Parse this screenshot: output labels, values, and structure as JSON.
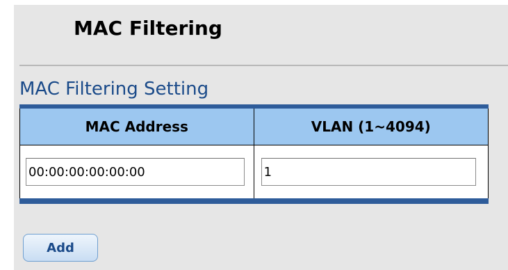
{
  "page": {
    "title": "MAC Filtering"
  },
  "section": {
    "title": "MAC Filtering Setting"
  },
  "table": {
    "headers": {
      "mac_address": "MAC Address",
      "vlan": "VLAN (1~4094)"
    },
    "row": {
      "mac_address_value": "00:00:00:00:00:00",
      "vlan_value": "1"
    }
  },
  "actions": {
    "add_label": "Add"
  },
  "colors": {
    "section_title": "#1a4a89",
    "table_border": "#2e5c9a",
    "header_background": "#9cc7f0",
    "panel_background": "#e6e6e6"
  }
}
